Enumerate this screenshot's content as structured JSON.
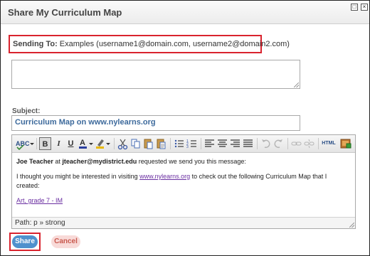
{
  "dialog": {
    "title": "Share My Curriculum Map",
    "window_buttons": [
      "restore-icon",
      "close-icon"
    ]
  },
  "sending_to": {
    "label": "Sending To:",
    "value": "Examples (username1@domain.com, username2@domain2.com)"
  },
  "recipients_field": {
    "value": ""
  },
  "subject": {
    "label": "Subject:",
    "value": "Curriculum Map on www.nylearns.org"
  },
  "toolbar": {
    "items": [
      "spellcheck-icon",
      "bold-icon",
      "italic-icon",
      "underline-icon",
      "font-color-icon",
      "highlight-color-icon",
      "cut-icon",
      "copy-icon",
      "paste-icon",
      "paste-text-icon",
      "bullet-list-icon",
      "numbered-list-icon",
      "align-left-icon",
      "align-center-icon",
      "align-right-icon",
      "justify-icon",
      "undo-icon",
      "redo-icon",
      "link-icon",
      "unlink-icon",
      "html-source-icon",
      "insert-media-icon"
    ],
    "html_label": "HTML"
  },
  "message": {
    "sender_name": "Joe Teacher",
    "at_text": "at",
    "sender_email": "jteacher@mydistrict.edu",
    "request_text": "requested we send you this message:",
    "body_before_link": "I thought you might be interested in visiting",
    "link_text": "www.nylearns.org",
    "body_after_link": "to check out the following Curriculum Map that I created:",
    "map_link": "Art, grade 7 - IM"
  },
  "path": "Path: p » strong",
  "buttons": {
    "share": "Share",
    "cancel": "Cancel"
  },
  "colors": {
    "highlight_border": "#d9232e",
    "share_button": "#4f91cd",
    "cancel_button_bg": "#f8dad8",
    "subject_text": "#3d6a9c",
    "link": "#6a2ea1"
  }
}
